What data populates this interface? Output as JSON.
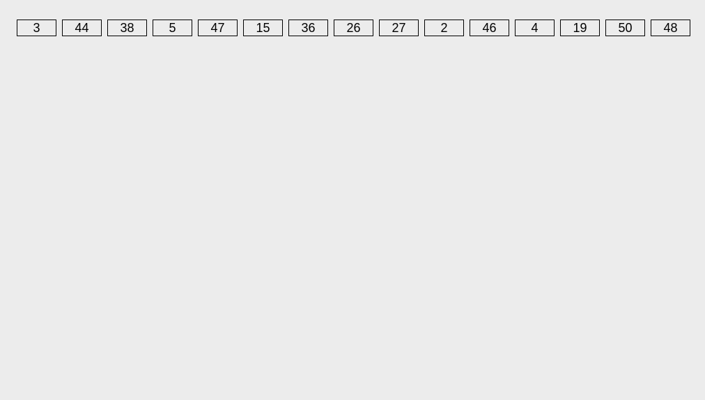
{
  "number_row": {
    "items": [
      {
        "value": "3"
      },
      {
        "value": "44"
      },
      {
        "value": "38"
      },
      {
        "value": "5"
      },
      {
        "value": "47"
      },
      {
        "value": "15"
      },
      {
        "value": "36"
      },
      {
        "value": "26"
      },
      {
        "value": "27"
      },
      {
        "value": "2"
      },
      {
        "value": "46"
      },
      {
        "value": "4"
      },
      {
        "value": "19"
      },
      {
        "value": "50"
      },
      {
        "value": "48"
      }
    ]
  }
}
